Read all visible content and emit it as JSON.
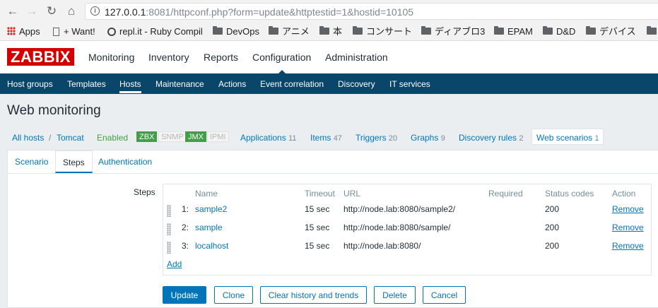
{
  "browser": {
    "url_host": "127.0.0.1",
    "url_rest": ":8081/httpconf.php?form=update&httptestid=1&hostid=10105",
    "bookmarks": [
      "Apps",
      "+ Want!",
      "repl.it - Ruby Compil",
      "DevOps",
      "アニメ",
      "本",
      "コンサート",
      "ディアブロ3",
      "EPAM",
      "D&D",
      "デバイス"
    ]
  },
  "header": {
    "logo": "ZABBIX",
    "menu": [
      "Monitoring",
      "Inventory",
      "Reports",
      "Configuration",
      "Administration"
    ],
    "active_menu": "Configuration"
  },
  "subnav": {
    "items": [
      "Host groups",
      "Templates",
      "Hosts",
      "Maintenance",
      "Actions",
      "Event correlation",
      "Discovery",
      "IT services"
    ],
    "active": "Hosts"
  },
  "page_title": "Web monitoring",
  "host_nav": {
    "all_hosts": "All hosts",
    "separator": "/",
    "host": "Tomcat",
    "status": "Enabled",
    "availability": [
      {
        "label": "ZBX",
        "on": true
      },
      {
        "label": "SNMP",
        "on": false
      },
      {
        "label": "JMX",
        "on": true
      },
      {
        "label": "IPMI",
        "on": false
      }
    ],
    "links": [
      {
        "label": "Applications",
        "count": "11"
      },
      {
        "label": "Items",
        "count": "47"
      },
      {
        "label": "Triggers",
        "count": "20"
      },
      {
        "label": "Graphs",
        "count": "9"
      },
      {
        "label": "Discovery rules",
        "count": "2"
      },
      {
        "label": "Web scenarios",
        "count": "1"
      }
    ]
  },
  "tabs": [
    "Scenario",
    "Steps",
    "Authentication"
  ],
  "active_tab": "Steps",
  "steps": {
    "label": "Steps",
    "columns": [
      "Name",
      "Timeout",
      "URL",
      "Required",
      "Status codes",
      "Action"
    ],
    "rows": [
      {
        "num": "1:",
        "name": "sample2",
        "timeout": "15 sec",
        "url": "http://node.lab:8080/sample2/",
        "required": "",
        "status_codes": "200",
        "action": "Remove"
      },
      {
        "num": "2:",
        "name": "sample",
        "timeout": "15 sec",
        "url": "http://node.lab:8080/sample/",
        "required": "",
        "status_codes": "200",
        "action": "Remove"
      },
      {
        "num": "3:",
        "name": "localhost",
        "timeout": "15 sec",
        "url": "http://node.lab:8080/",
        "required": "",
        "status_codes": "200",
        "action": "Remove"
      }
    ],
    "add_label": "Add"
  },
  "buttons": {
    "update": "Update",
    "clone": "Clone",
    "clear_history": "Clear history and trends",
    "delete": "Delete",
    "cancel": "Cancel"
  },
  "colors": {
    "header_bg": "#0a466a",
    "link": "#0275b8",
    "logo_bg": "#d40000",
    "enabled": "#429e47"
  }
}
